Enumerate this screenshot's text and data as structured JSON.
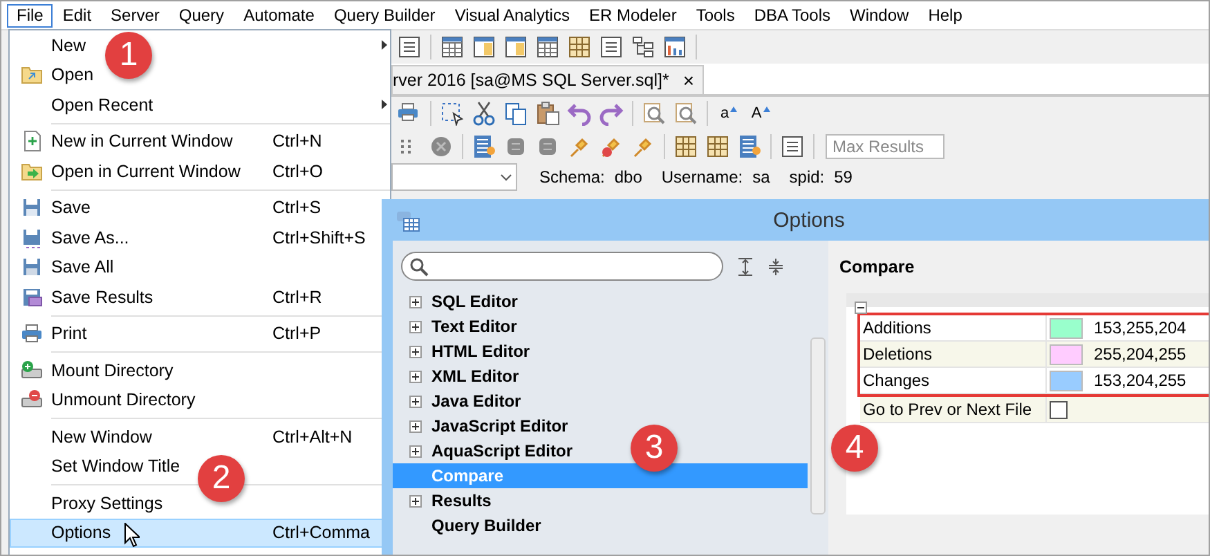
{
  "menubar": [
    {
      "label": "File",
      "selected": true
    },
    {
      "label": "Edit",
      "selected": false
    },
    {
      "label": "Server",
      "selected": false
    },
    {
      "label": "Query",
      "selected": false
    },
    {
      "label": "Automate",
      "selected": false
    },
    {
      "label": "Query Builder",
      "selected": false
    },
    {
      "label": "Visual Analytics",
      "selected": false
    },
    {
      "label": "ER Modeler",
      "selected": false
    },
    {
      "label": "Tools",
      "selected": false
    },
    {
      "label": "DBA Tools",
      "selected": false
    },
    {
      "label": "Window",
      "selected": false
    },
    {
      "label": "Help",
      "selected": false
    }
  ],
  "editor_tab": {
    "title": "rver 2016 [sa@MS SQL Server.sql]*",
    "close": "×"
  },
  "font_buttons": [
    "a",
    "A"
  ],
  "max_results": {
    "placeholder": "Max Results"
  },
  "session": [
    {
      "label": "Schema:",
      "value": "dbo"
    },
    {
      "label": "Username:",
      "value": "sa"
    },
    {
      "label": "spid:",
      "value": "59"
    }
  ],
  "file_menu": [
    {
      "kind": "item",
      "label": "New",
      "submenu": true,
      "selected": false
    },
    {
      "kind": "item",
      "label": "Open",
      "submenu": false,
      "selected": false
    },
    {
      "kind": "item",
      "label": "Open Recent",
      "submenu": true,
      "selected": false
    },
    {
      "kind": "separator"
    },
    {
      "kind": "item",
      "label": "New in Current Window",
      "shortcut": "Ctrl+N",
      "submenu": false,
      "selected": false
    },
    {
      "kind": "item",
      "label": "Open in Current Window",
      "shortcut": "Ctrl+O",
      "submenu": false,
      "selected": false
    },
    {
      "kind": "separator"
    },
    {
      "kind": "item",
      "label": "Save",
      "shortcut": "Ctrl+S",
      "submenu": false,
      "selected": false
    },
    {
      "kind": "item",
      "label": "Save As...",
      "shortcut": "Ctrl+Shift+S",
      "submenu": false,
      "selected": false
    },
    {
      "kind": "item",
      "label": "Save All",
      "submenu": false,
      "selected": false
    },
    {
      "kind": "item",
      "label": "Save Results",
      "shortcut": "Ctrl+R",
      "submenu": false,
      "selected": false
    },
    {
      "kind": "separator"
    },
    {
      "kind": "item",
      "label": "Print",
      "shortcut": "Ctrl+P",
      "submenu": false,
      "selected": false
    },
    {
      "kind": "separator"
    },
    {
      "kind": "item",
      "label": "Mount Directory",
      "submenu": false,
      "selected": false
    },
    {
      "kind": "item",
      "label": "Unmount Directory",
      "submenu": false,
      "selected": false
    },
    {
      "kind": "separator"
    },
    {
      "kind": "item",
      "label": "New Window",
      "shortcut": "Ctrl+Alt+N",
      "submenu": false,
      "selected": false
    },
    {
      "kind": "item",
      "label": "Set Window Title",
      "submenu": false,
      "selected": false
    },
    {
      "kind": "separator"
    },
    {
      "kind": "item",
      "label": "Proxy Settings",
      "submenu": false,
      "selected": false
    },
    {
      "kind": "item",
      "label": "Options",
      "shortcut": "Ctrl+Comma",
      "submenu": false,
      "selected": true
    }
  ],
  "options_dialog": {
    "title": "Options",
    "tree": [
      {
        "label": "SQL Editor",
        "expandable": true,
        "selected": false
      },
      {
        "label": "Text Editor",
        "expandable": true,
        "selected": false
      },
      {
        "label": "HTML Editor",
        "expandable": true,
        "selected": false
      },
      {
        "label": "XML Editor",
        "expandable": true,
        "selected": false
      },
      {
        "label": "Java Editor",
        "expandable": true,
        "selected": false
      },
      {
        "label": "JavaScript Editor",
        "expandable": true,
        "selected": false
      },
      {
        "label": "AquaScript Editor",
        "expandable": true,
        "selected": false
      },
      {
        "label": "Compare",
        "expandable": false,
        "selected": true
      },
      {
        "label": "Results",
        "expandable": true,
        "selected": false
      },
      {
        "label": "Query Builder",
        "expandable": false,
        "selected": false
      }
    ],
    "page_title": "Compare",
    "group_expanded": true,
    "properties": [
      {
        "kind": "color",
        "label": "Additions",
        "color": "#99ffcc",
        "value": "153,255,204",
        "highlighted": true
      },
      {
        "kind": "color",
        "label": "Deletions",
        "color": "#ffccff",
        "value": "255,204,255",
        "highlighted": true
      },
      {
        "kind": "color",
        "label": "Changes",
        "color": "#99ccff",
        "value": "153,204,255",
        "highlighted": true
      },
      {
        "kind": "checkbox",
        "label": "Go to Prev or Next File",
        "checked": false,
        "highlighted": false
      }
    ]
  },
  "callouts": [
    "1",
    "2",
    "3",
    "4"
  ]
}
